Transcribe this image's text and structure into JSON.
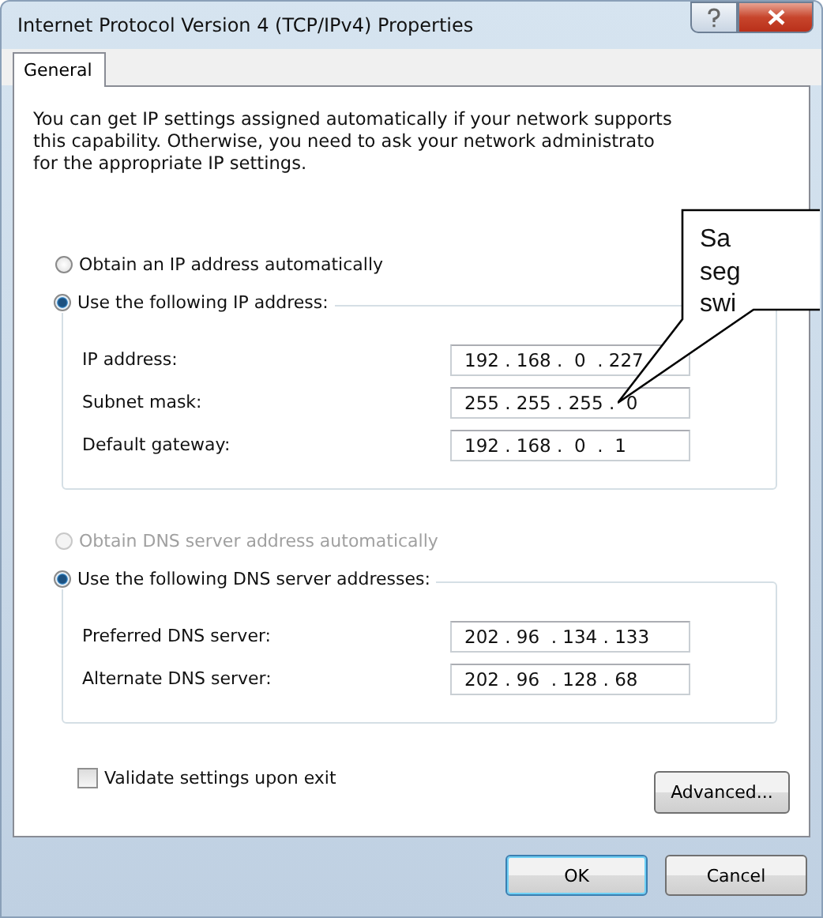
{
  "window": {
    "title": "Internet Protocol Version 4 (TCP/IPv4) Properties"
  },
  "tabs": [
    {
      "label": "General",
      "selected": true
    }
  ],
  "description": [
    "You can get IP settings assigned automatically if your network supports",
    "this capability. Otherwise, you need to ask your network administrato",
    "for the appropriate IP settings."
  ],
  "ip_options": [
    {
      "label": "Obtain an IP address automatically",
      "selected": false,
      "disabled": false
    },
    {
      "label": "Use the following IP address:",
      "selected": true,
      "disabled": false
    }
  ],
  "ip_fields": [
    {
      "label": "IP address:",
      "value": "192 . 168 .  0  . 227"
    },
    {
      "label": "Subnet mask:",
      "value": "255 . 255 . 255 .  0"
    },
    {
      "label": "Default gateway:",
      "value": "192 . 168 .  0  .  1"
    }
  ],
  "dns_options": [
    {
      "label": "Obtain DNS server address automatically",
      "selected": false,
      "disabled": true
    },
    {
      "label": "Use the following DNS server addresses:",
      "selected": true,
      "disabled": false
    }
  ],
  "dns_fields": [
    {
      "label": "Preferred DNS server:",
      "value": "202 . 96  . 134 . 133"
    },
    {
      "label": "Alternate DNS server:",
      "value": "202 . 96  . 128 . 68"
    }
  ],
  "validate": {
    "label": "Validate settings upon exit",
    "checked": false
  },
  "advanced_button": "Advanced...",
  "buttons": [
    {
      "label": "OK",
      "default": true
    },
    {
      "label": "Cancel",
      "default": false
    }
  ],
  "callout": {
    "lines": [
      "Sa",
      "seg",
      "swi"
    ]
  }
}
